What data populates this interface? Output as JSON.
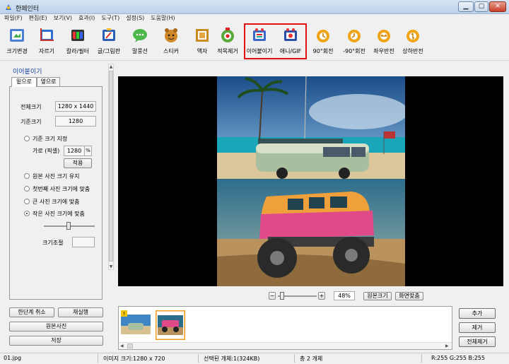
{
  "window": {
    "title": "한페인터"
  },
  "menu": [
    "파일(F)",
    "편집(E)",
    "보기(V)",
    "효과(I)",
    "도구(T)",
    "설정(S)",
    "도움말(H)"
  ],
  "toolbar": [
    {
      "label": "크기변경",
      "icon": "resize-icon"
    },
    {
      "label": "자르기",
      "icon": "crop-icon"
    },
    {
      "label": "칼라/필터",
      "icon": "color-filter-icon"
    },
    {
      "label": "글/그림판",
      "icon": "text-paint-icon"
    },
    {
      "label": "말풍선",
      "icon": "speech-bubble-icon"
    },
    {
      "label": "스티커",
      "icon": "sticker-icon"
    },
    {
      "label": "액자",
      "icon": "frame-icon"
    },
    {
      "label": "적목제거",
      "icon": "red-eye-icon"
    },
    {
      "label": "이어붙이기",
      "icon": "merge-icon"
    },
    {
      "label": "애니/GIF",
      "icon": "gif-icon"
    },
    {
      "label": "90°회전",
      "icon": "rotate-cw-icon"
    },
    {
      "label": "-90°회전",
      "icon": "rotate-ccw-icon"
    },
    {
      "label": "좌우반전",
      "icon": "flip-horizontal-icon"
    },
    {
      "label": "상하반전",
      "icon": "flip-vertical-icon"
    }
  ],
  "panel": {
    "title": "이어붙이기",
    "tabs": [
      "밑으로",
      "옆으로"
    ],
    "total_size_label": "전체크기",
    "total_size_value": "1280 x 1440",
    "base_size_label": "기준크기",
    "base_size_value": "1280",
    "set_base_label": "기준 크기 지정",
    "width_label": "가로 (픽셀)",
    "width_value": "1280",
    "apply_label": "적용",
    "options": [
      "원본 사진 크기 유지",
      "첫번째 사진 크기에 맞춤",
      "큰 사진 크기에 맞춤",
      "작은 사진 크기에 맞춤"
    ],
    "selected_option": 3,
    "size_adjust_label": "크기조절"
  },
  "left_buttons": {
    "undo": "한단계 취소",
    "redo": "재실행",
    "original": "원본사진",
    "save": "저장"
  },
  "zoom": {
    "percent": "48%",
    "original_size": "원본크기",
    "fit_screen": "화면맞춤"
  },
  "thumbs_buttons": {
    "add": "추가",
    "remove": "제거",
    "remove_all": "전체제거"
  },
  "status": {
    "file": "01.jpg",
    "image_size": "이미지 크기:1280 x 720",
    "selected": "선택된 개체:1(324KB)",
    "total": "총 2 개체",
    "color": "R:255 G:255 B:255"
  },
  "colors": {
    "highlight": "#e01010",
    "panel_title": "#1846a8",
    "canvas": "#000000"
  }
}
